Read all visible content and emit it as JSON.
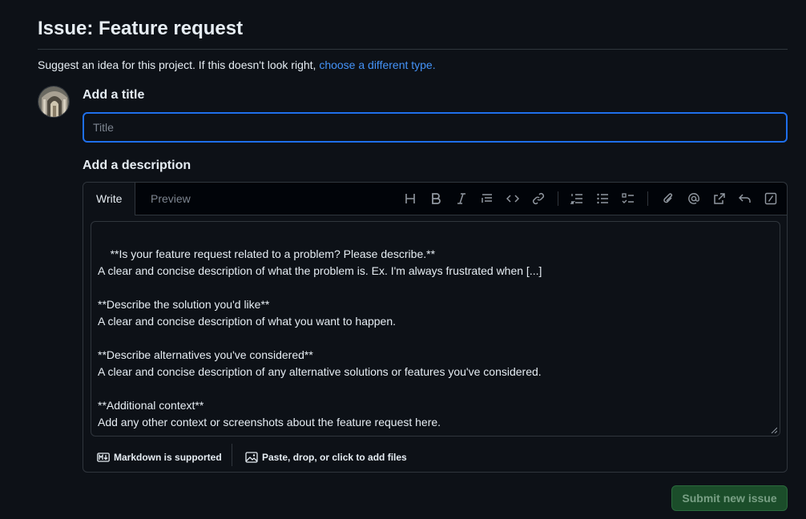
{
  "header": {
    "title": "Issue: Feature request",
    "subtitle_text": "Suggest an idea for this project. If this doesn't look right,",
    "subtitle_link": "choose a different type."
  },
  "form": {
    "title_label": "Add a title",
    "title_placeholder": "Title",
    "title_value": "",
    "description_label": "Add a description",
    "tabs": [
      {
        "label": "Write",
        "active": true
      },
      {
        "label": "Preview",
        "active": false
      }
    ],
    "toolbar": [
      "heading-icon",
      "bold-icon",
      "italic-icon",
      "quote-icon",
      "code-icon",
      "link-icon",
      "ordered-list-icon",
      "unordered-list-icon",
      "task-list-icon",
      "attach-icon",
      "mention-icon",
      "reference-icon",
      "undo-icon",
      "slash-command-icon"
    ],
    "body": "**Is your feature request related to a problem? Please describe.**\nA clear and concise description of what the problem is. Ex. I'm always frustrated when [...]\n\n**Describe the solution you'd like**\nA clear and concise description of what you want to happen.\n\n**Describe alternatives you've considered**\nA clear and concise description of any alternative solutions or features you've considered.\n\n**Additional context**\nAdd any other context or screenshots about the feature request here.",
    "markdown_note": "Markdown is supported",
    "attach_note": "Paste, drop, or click to add files",
    "submit_label": "Submit new issue"
  },
  "colors": {
    "background": "#0d1117",
    "accent_link": "#4493f8",
    "focus_border": "#1f6feb",
    "submit_bg": "#1b4d2a"
  }
}
